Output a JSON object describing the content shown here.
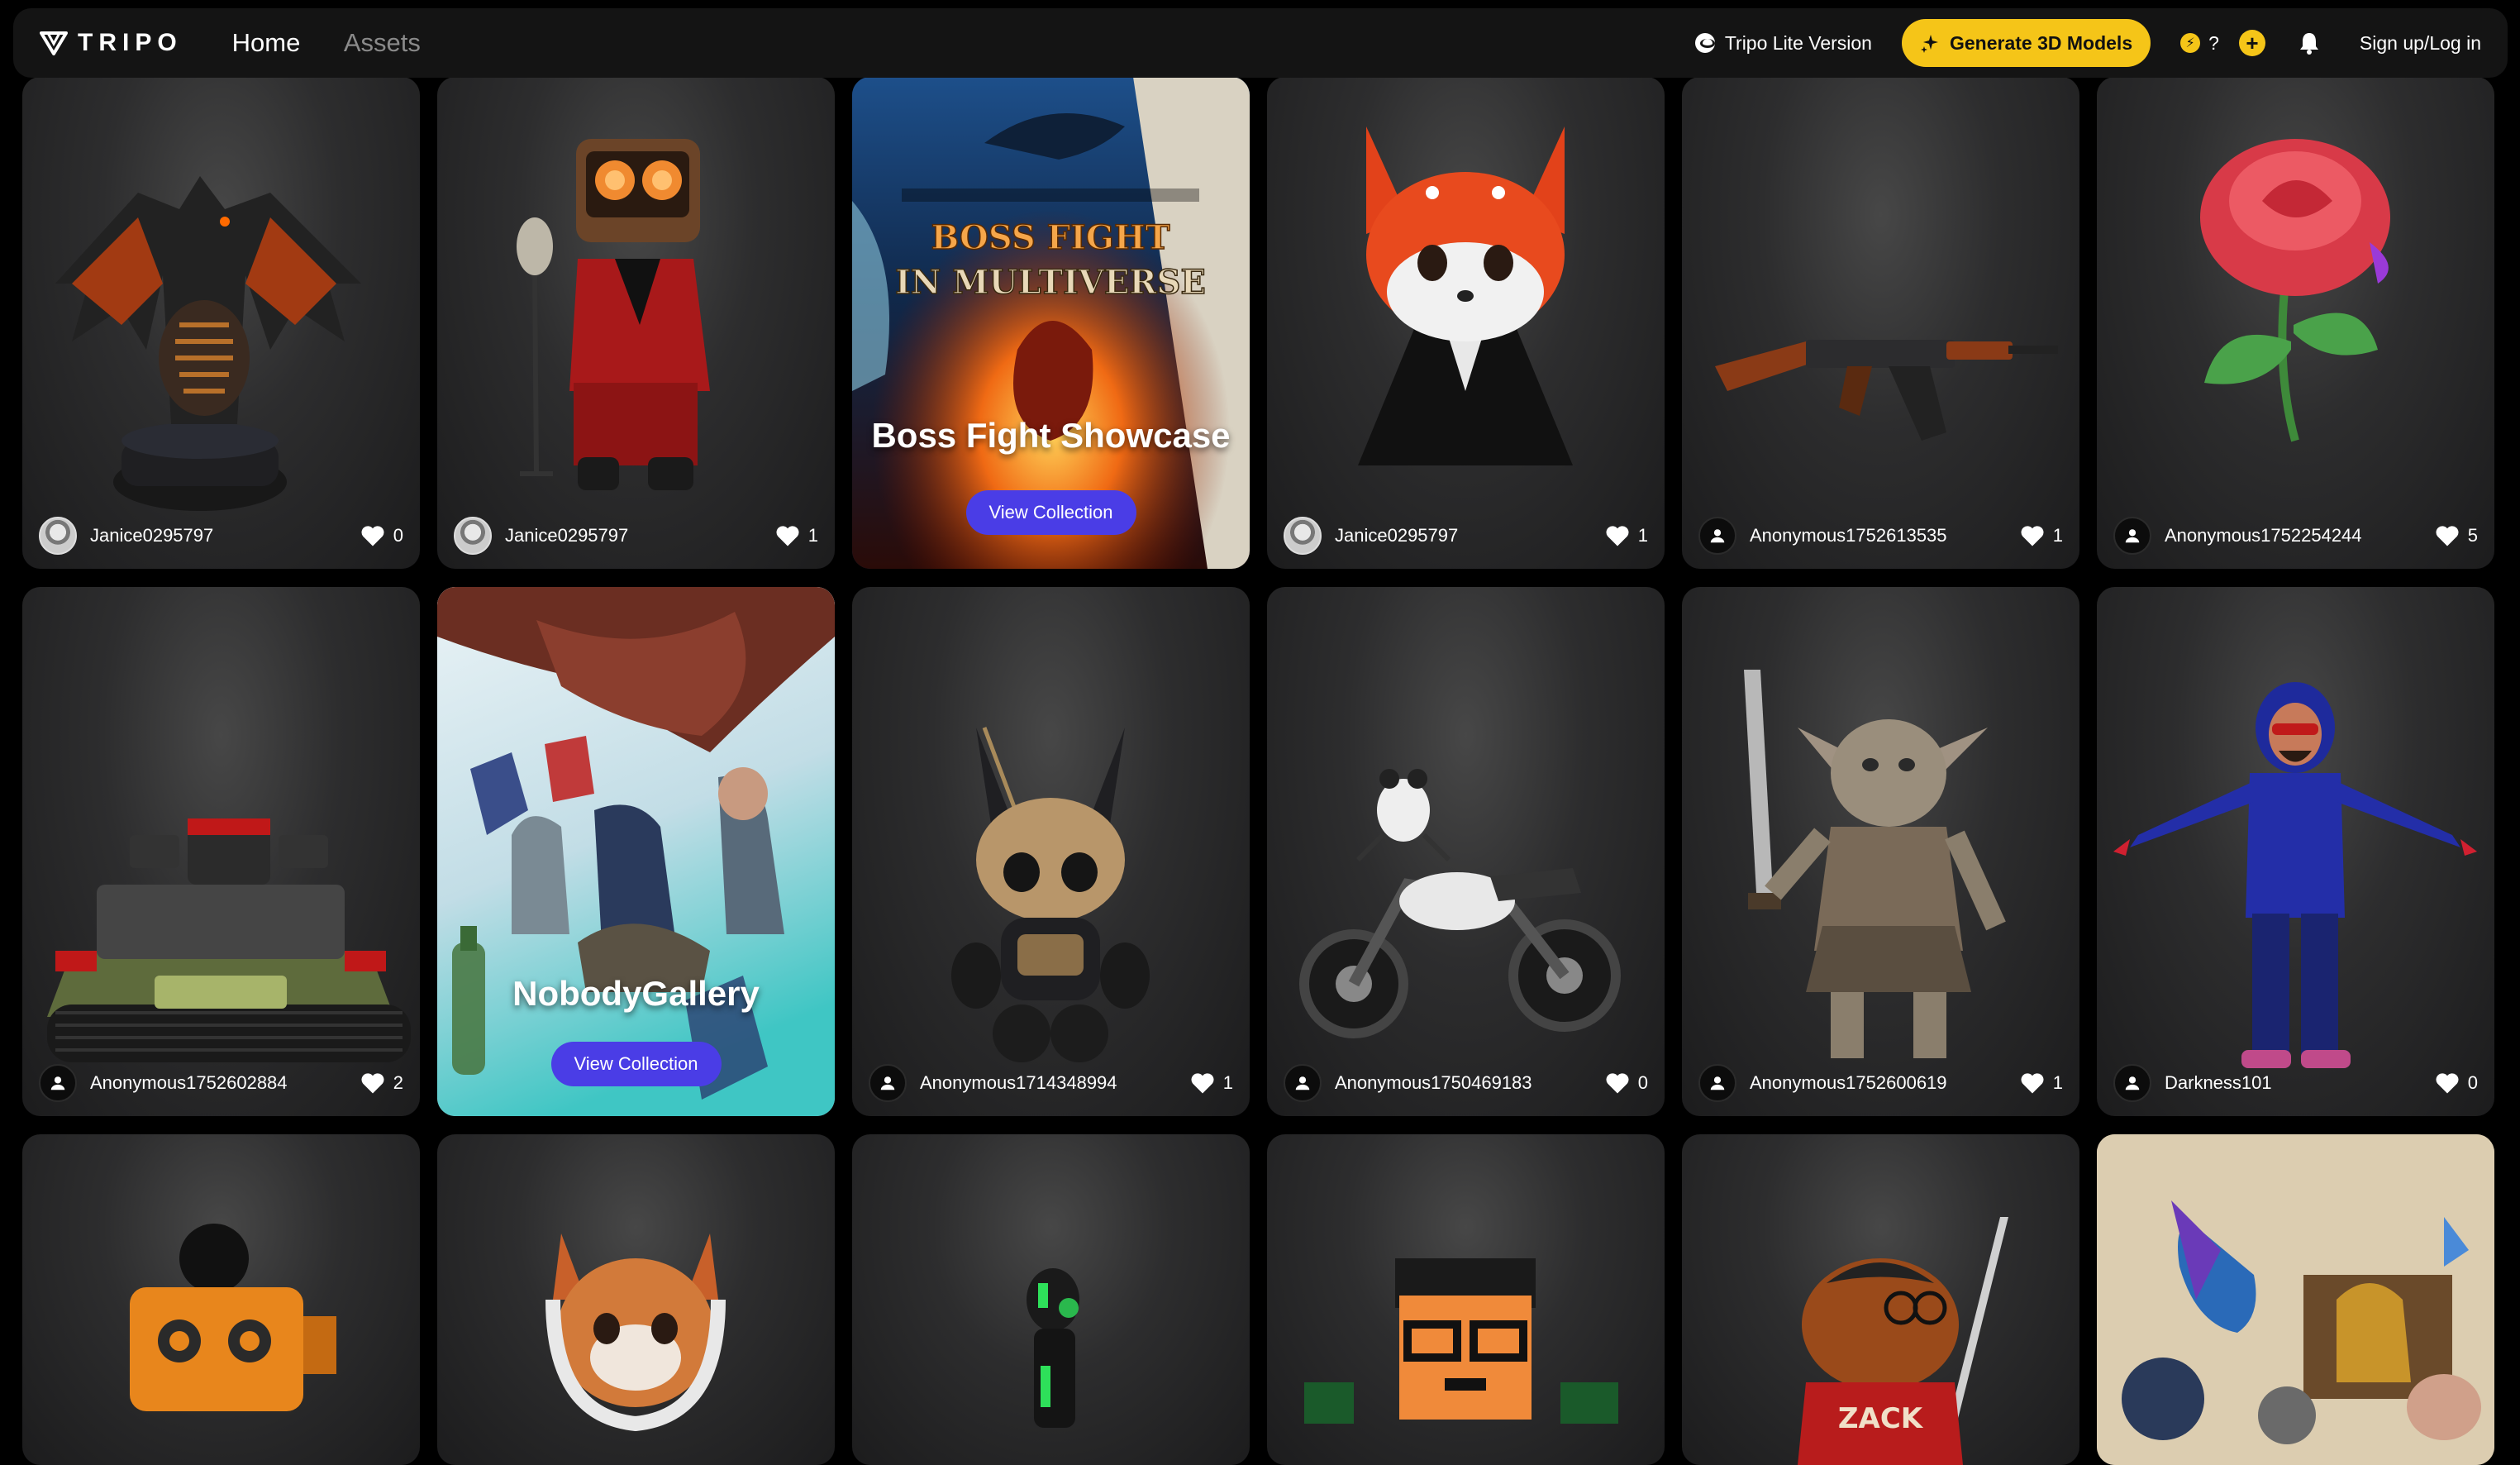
{
  "nav": {
    "logo": "TRIPO",
    "links": [
      "Home",
      "Assets"
    ],
    "lite_version": "Tripo Lite Version",
    "generate": "Generate 3D Models",
    "credits": "?",
    "signin": "Sign up/Log in"
  },
  "colors": {
    "accent": "#f5c518",
    "button": "#4a3de6",
    "background": "#000000"
  },
  "row1": [
    {
      "user": "Janice0295797",
      "likes": "0",
      "subject": "dragon"
    },
    {
      "user": "Janice0295797",
      "likes": "1",
      "subject": "speaker-head singer"
    },
    {
      "collection": "Boss Fight Showcase",
      "poster": "BOSS FIGHT IN MULTIVERSE",
      "button": "View Collection"
    },
    {
      "user": "Janice0295797",
      "likes": "1",
      "subject": "fox"
    },
    {
      "user": "Anonymous1752613535",
      "likes": "1",
      "subject": "rifle"
    },
    {
      "user": "Anonymous1752254244",
      "likes": "5",
      "subject": "rose"
    }
  ],
  "row2": [
    {
      "user": "Anonymous1752602884",
      "likes": "2",
      "subject": "tank"
    },
    {
      "collection": "NobodyGallery",
      "button": "View Collection"
    },
    {
      "user": "Anonymous1714348994",
      "likes": "1",
      "subject": "robot creature"
    },
    {
      "user": "Anonymous1750469183",
      "likes": "0",
      "subject": "motorcycle"
    },
    {
      "user": "Anonymous1752600619",
      "likes": "1",
      "subject": "goblin"
    },
    {
      "user": "Darkness101",
      "likes": "0",
      "subject": "hoodie man"
    }
  ],
  "row3": [
    {
      "subject": "robot"
    },
    {
      "subject": "astronaut cat"
    },
    {
      "subject": "figure"
    },
    {
      "subject": "pixel face"
    },
    {
      "subject": "bear",
      "text": "ZACK"
    },
    {
      "subject": "creatures"
    }
  ]
}
